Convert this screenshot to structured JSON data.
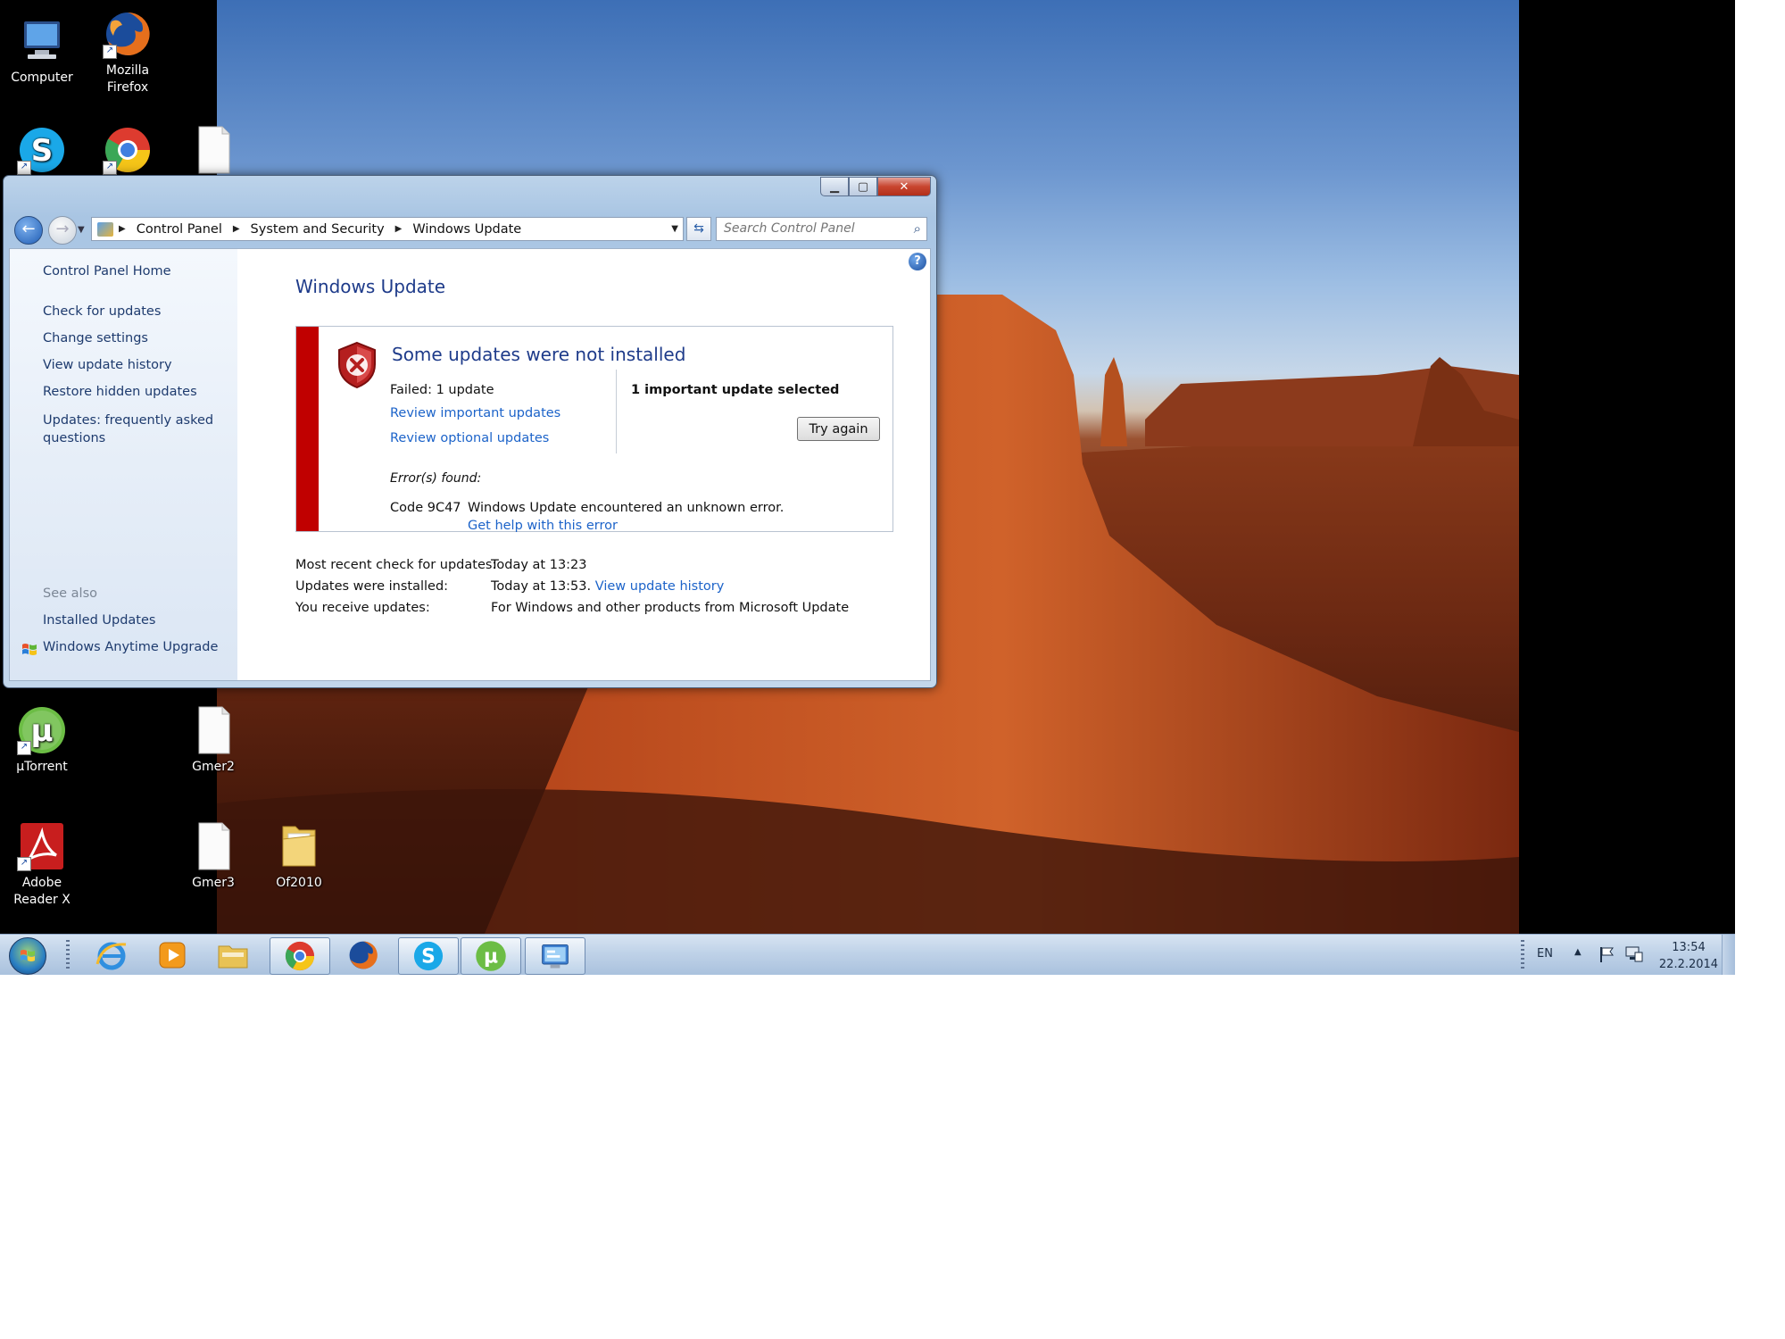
{
  "desktop": {
    "icons": [
      {
        "label": "Computer",
        "icon": "computer-icon"
      },
      {
        "label": "Mozilla Firefox",
        "icon": "firefox-icon"
      },
      {
        "label": "",
        "icon": "skype-icon"
      },
      {
        "label": "",
        "icon": "chrome-icon"
      },
      {
        "label": "",
        "icon": "document-icon"
      },
      {
        "label": "µTorrent",
        "icon": "utorrent-icon"
      },
      {
        "label": "Gmer2",
        "icon": "document-icon"
      },
      {
        "label": "Adobe Reader X",
        "icon": "adobe-reader-icon"
      },
      {
        "label": "Gmer3",
        "icon": "document-icon"
      },
      {
        "label": "Of2010",
        "icon": "folder-icon"
      }
    ]
  },
  "window": {
    "caption": {
      "minimize": "▁",
      "maximize": "▢",
      "close": "✕"
    },
    "nav": {
      "back": "←",
      "forward": "→"
    },
    "breadcrumb": [
      "Control Panel",
      "System and Security",
      "Windows Update"
    ],
    "search": {
      "placeholder": "Search Control Panel"
    },
    "sidebar": {
      "home": "Control Panel Home",
      "links": [
        "Check for updates",
        "Change settings",
        "View update history",
        "Restore hidden updates",
        "Updates: frequently asked questions"
      ],
      "see_also": "See also",
      "see_also_links": [
        "Installed Updates",
        "Windows Anytime Upgrade"
      ]
    },
    "help": "?",
    "main": {
      "title": "Windows Update",
      "error_box": {
        "heading": "Some updates were not installed",
        "failed": "Failed: 1 update",
        "review_important": "Review important updates",
        "review_optional": "Review optional updates",
        "selected": "1 important update selected",
        "try_again": "Try again",
        "errors_found": "Error(s) found:",
        "code": "Code 9C47",
        "message": "Windows Update encountered an unknown error.",
        "help_link": "Get help with this error"
      },
      "info": [
        {
          "label": "Most recent check for updates:",
          "value": "Today at 13:23",
          "link": ""
        },
        {
          "label": "Updates were installed:",
          "value": "Today at 13:53.",
          "link": "View update history"
        },
        {
          "label": "You receive updates:",
          "value": "For Windows and other products from Microsoft Update",
          "link": ""
        }
      ]
    }
  },
  "taskbar": {
    "language": "EN",
    "time": "13:54",
    "date": "22.2.2014",
    "tray_arrow": "▲"
  },
  "colors": {
    "link": "#1c63c9",
    "title": "#1e3b8a",
    "error_strip": "#c00000",
    "taskbar": "#bfd2e8"
  }
}
